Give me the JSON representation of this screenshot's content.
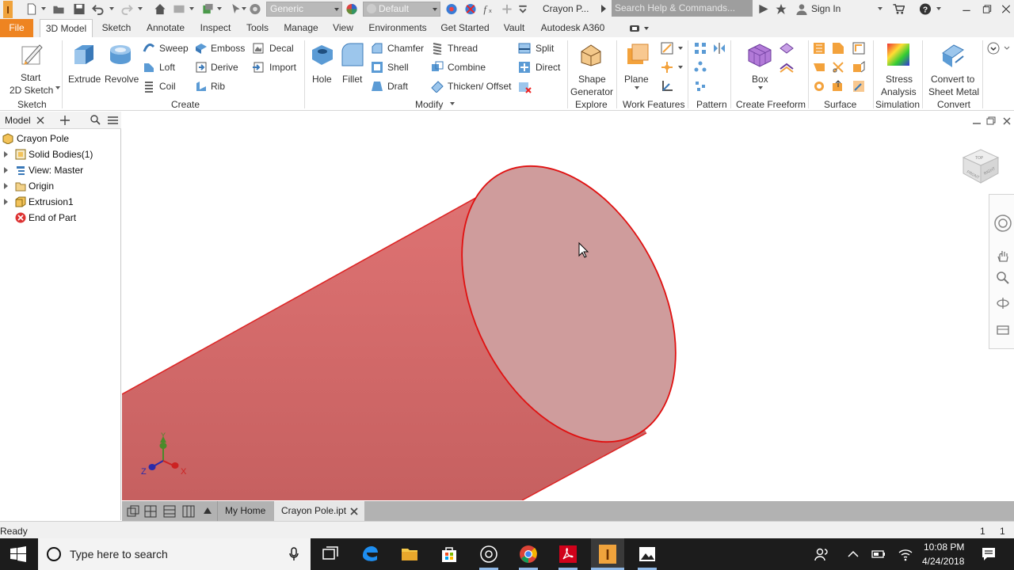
{
  "quick_access": {
    "appearance_value": "Generic",
    "material_value": "Default",
    "document_title": "Crayon P...",
    "search_placeholder": "Search Help & Commands...",
    "sign_in_label": "Sign In"
  },
  "ribbon_tabs": [
    "File",
    "3D Model",
    "Sketch",
    "Annotate",
    "Inspect",
    "Tools",
    "Manage",
    "View",
    "Environments",
    "Get Started",
    "Vault",
    "Autodesk A360"
  ],
  "ribbon": {
    "sketch": {
      "start_sketch_line1": "Start",
      "start_sketch_line2": "2D Sketch",
      "group_label": "Sketch"
    },
    "create": {
      "extrude": "Extrude",
      "revolve": "Revolve",
      "sweep": "Sweep",
      "loft": "Loft",
      "coil": "Coil",
      "emboss": "Emboss",
      "derive": "Derive",
      "rib": "Rib",
      "decal": "Decal",
      "import": "Import",
      "group_label": "Create"
    },
    "modify": {
      "hole": "Hole",
      "fillet": "Fillet",
      "chamfer": "Chamfer",
      "shell": "Shell",
      "draft": "Draft",
      "thread": "Thread",
      "combine": "Combine",
      "thicken_offset": "Thicken/ Offset",
      "split": "Split",
      "direct": "Direct",
      "group_label": "Modify"
    },
    "explore": {
      "shape_generator_line1": "Shape",
      "shape_generator_line2": "Generator",
      "group_label": "Explore"
    },
    "work_features": {
      "plane": "Plane",
      "group_label": "Work Features"
    },
    "pattern": {
      "group_label": "Pattern"
    },
    "create_freeform": {
      "box": "Box",
      "group_label": "Create Freeform"
    },
    "surface": {
      "group_label": "Surface"
    },
    "simulation": {
      "line1": "Stress",
      "line2": "Analysis",
      "group_label": "Simulation"
    },
    "convert": {
      "line1": "Convert to",
      "line2": "Sheet Metal",
      "group_label": "Convert"
    }
  },
  "browser": {
    "tab_label": "Model",
    "tree": [
      {
        "label": "Crayon Pole",
        "icon": "part-icon",
        "expandable": false
      },
      {
        "label": "Solid Bodies(1)",
        "icon": "solid-bodies-icon",
        "expandable": true
      },
      {
        "label": "View: Master",
        "icon": "view-icon",
        "expandable": true
      },
      {
        "label": "Origin",
        "icon": "folder-icon",
        "expandable": true
      },
      {
        "label": "Extrusion1",
        "icon": "extrusion-icon",
        "expandable": true
      },
      {
        "label": "End of Part",
        "icon": "end-of-part-icon",
        "expandable": false
      }
    ]
  },
  "viewport": {
    "model_color": "#e07474",
    "model_face_color": "#cf9c9c",
    "edge_color": "#e01010",
    "triad": {
      "x": "X",
      "y": "Y",
      "z": "Z"
    }
  },
  "document_tabs": {
    "home_label": "My Home",
    "active_label": "Crayon Pole.ipt"
  },
  "status": {
    "text": "Ready",
    "count1": "1",
    "count2": "1"
  },
  "taskbar": {
    "search_placeholder": "Type here to search",
    "time": "10:08 PM",
    "date": "4/24/2018"
  },
  "colors": {
    "accent_orange": "#ee8421",
    "taskbar": "#1c1c1c"
  }
}
